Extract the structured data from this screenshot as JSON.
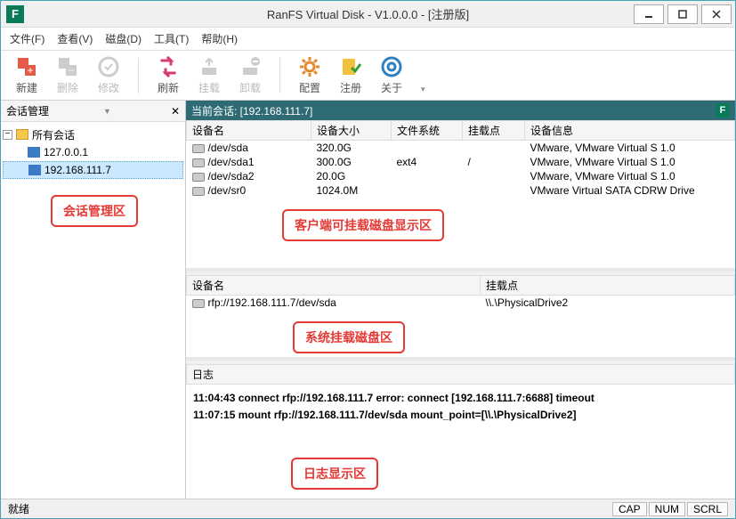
{
  "title": "RanFS Virtual Disk - V1.0.0.0 - [注册版]",
  "app_icon_letter": "F",
  "menu": [
    "文件(F)",
    "查看(V)",
    "磁盘(D)",
    "工具(T)",
    "帮助(H)"
  ],
  "toolbar": {
    "new": "新建",
    "delete": "删除",
    "modify": "修改",
    "refresh": "刷新",
    "mount": "挂载",
    "unmount": "卸载",
    "config": "配置",
    "register": "注册",
    "about": "关于"
  },
  "left": {
    "header": "会话管理",
    "root": "所有会话",
    "nodes": [
      "127.0.0.1",
      "192.168.111.7"
    ],
    "annotation": "会话管理区"
  },
  "session_header": "当前会话: [192.168.111.7]",
  "devcols": [
    "设备名",
    "设备大小",
    "文件系统",
    "挂载点",
    "设备信息"
  ],
  "devices": [
    {
      "name": "/dev/sda",
      "size": "320.0G",
      "fs": "",
      "mp": "",
      "info": "VMware, VMware Virtual S 1.0"
    },
    {
      "name": "/dev/sda1",
      "size": "300.0G",
      "fs": "ext4",
      "mp": "/",
      "info": "VMware, VMware Virtual S 1.0"
    },
    {
      "name": "/dev/sda2",
      "size": "20.0G",
      "fs": "",
      "mp": "",
      "info": "VMware, VMware Virtual S 1.0"
    },
    {
      "name": "/dev/sr0",
      "size": "1024.0M",
      "fs": "",
      "mp": "",
      "info": "VMware Virtual SATA CDRW Drive"
    }
  ],
  "devannot": "客户端可挂载磁盘显示区",
  "mntcols": [
    "设备名",
    "挂载点"
  ],
  "mounts": [
    {
      "name": "rfp://192.168.111.7/dev/sda",
      "mp": "\\\\.\\PhysicalDrive2"
    }
  ],
  "mntannot": "系统挂载磁盘区",
  "loghdr": "日志",
  "logs": [
    "11:04:43 connect rfp://192.168.111.7 error: connect [192.168.111.7:6688] timeout",
    "11:07:15 mount rfp://192.168.111.7/dev/sda mount_point=[\\\\.\\PhysicalDrive2]"
  ],
  "logannot": "日志显示区",
  "status": {
    "ready": "就绪",
    "cells": [
      "CAP",
      "NUM",
      "SCRL"
    ]
  }
}
